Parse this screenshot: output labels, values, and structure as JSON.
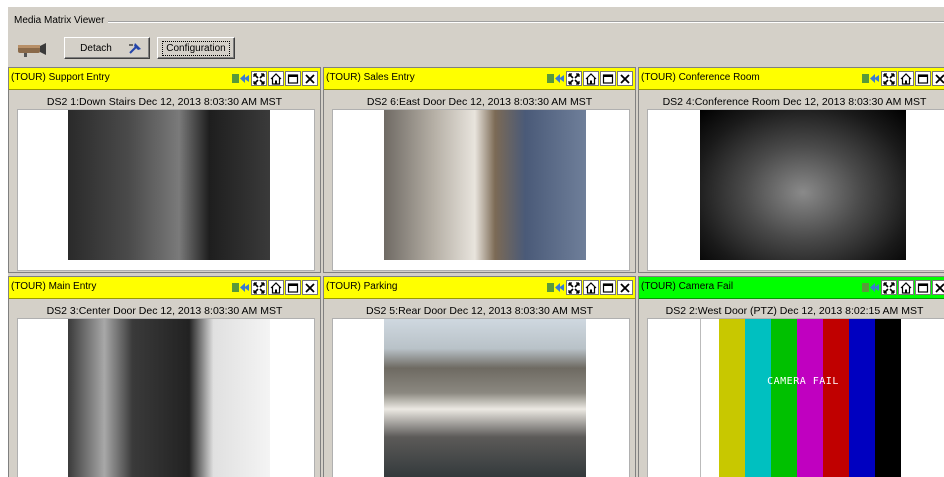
{
  "window": {
    "title": "Media Matrix Viewer"
  },
  "toolbar": {
    "detach_label": "Detach",
    "configuration_label": "Configuration"
  },
  "colors": {
    "header_yellow": "#ffff00",
    "header_green": "#00ff00",
    "panel_gray": "#d4d0c8"
  },
  "tiles": [
    {
      "title": "(TOUR) Support Entry",
      "caption": "DS2 1:Down Stairs Dec 12, 2013 8:03:30 AM MST",
      "status": "yellow"
    },
    {
      "title": "(TOUR) Sales Entry",
      "caption": "DS2 6:East Door Dec 12, 2013 8:03:30 AM MST",
      "status": "yellow"
    },
    {
      "title": "(TOUR) Conference Room",
      "caption": "DS2 4:Conference Room Dec 12, 2013 8:03:30 AM MST",
      "status": "yellow"
    },
    {
      "title": "(TOUR) Main Entry",
      "caption": "DS2 3:Center Door Dec 12, 2013 8:03:30 AM MST",
      "status": "yellow"
    },
    {
      "title": "(TOUR) Parking",
      "caption": "DS2 5:Rear Door Dec 12, 2013 8:03:30 AM MST",
      "status": "yellow"
    },
    {
      "title": "(TOUR) Camera Fail",
      "caption": "DS2 2:West Door (PTZ) Dec 12, 2013 8:02:15 AM MST",
      "status": "green",
      "overlay": "CAMERA FAIL"
    }
  ],
  "icons": [
    "expand-arrow-icon",
    "fullscreen-icon",
    "home-icon",
    "maximize-icon",
    "close-icon"
  ]
}
